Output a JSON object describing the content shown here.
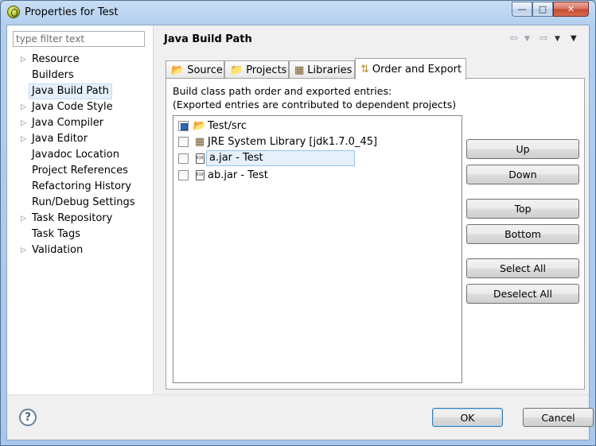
{
  "window": {
    "title": "Properties for Test"
  },
  "filter": {
    "placeholder": "type filter text"
  },
  "tree": [
    {
      "label": "Resource",
      "expandable": true
    },
    {
      "label": "Builders",
      "expandable": false
    },
    {
      "label": "Java Build Path",
      "expandable": false,
      "selected": true
    },
    {
      "label": "Java Code Style",
      "expandable": true
    },
    {
      "label": "Java Compiler",
      "expandable": true
    },
    {
      "label": "Java Editor",
      "expandable": true
    },
    {
      "label": "Javadoc Location",
      "expandable": false
    },
    {
      "label": "Project References",
      "expandable": false
    },
    {
      "label": "Refactoring History",
      "expandable": false
    },
    {
      "label": "Run/Debug Settings",
      "expandable": false
    },
    {
      "label": "Task Repository",
      "expandable": true
    },
    {
      "label": "Task Tags",
      "expandable": false
    },
    {
      "label": "Validation",
      "expandable": true
    }
  ],
  "page": {
    "title": "Java Build Path"
  },
  "tabs": [
    {
      "label": "Source",
      "icon": "source-folder-icon"
    },
    {
      "label": "Projects",
      "icon": "projects-folder-icon"
    },
    {
      "label": "Libraries",
      "icon": "libraries-icon"
    },
    {
      "label": "Order and Export",
      "icon": "order-export-icon",
      "active": true
    }
  ],
  "order_export": {
    "line1": "Build class path order and exported entries:",
    "line2": "(Exported entries are contributed to dependent projects)",
    "entries": [
      {
        "label": "Test/src",
        "icon": "source-folder-icon",
        "checked": true
      },
      {
        "label": "JRE System Library [jdk1.7.0_45]",
        "icon": "library-icon",
        "checked": false
      },
      {
        "label": "a.jar - Test",
        "icon": "jar-icon",
        "checked": false,
        "selected": true
      },
      {
        "label": "ab.jar - Test",
        "icon": "jar-icon",
        "checked": false
      }
    ],
    "buttons": {
      "up": "Up",
      "down": "Down",
      "top": "Top",
      "bottom": "Bottom",
      "select_all": "Select All",
      "deselect_all": "Deselect All"
    }
  },
  "footer": {
    "ok": "OK",
    "cancel": "Cancel",
    "help_glyph": "?"
  }
}
